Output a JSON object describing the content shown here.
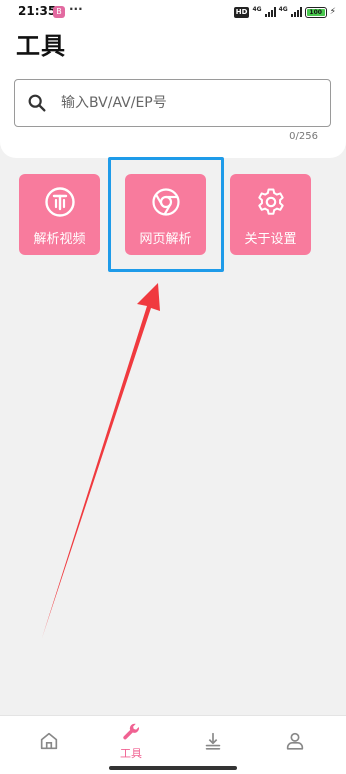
{
  "status_bar": {
    "time": "21:35",
    "app_icon_glyph": "B",
    "more_dots": "···",
    "hd": "HD",
    "network_1": "4G",
    "network_2": "4G",
    "battery": "100",
    "battery_level_percent": 100,
    "charging_icon": "bolt-icon"
  },
  "header": {
    "title": "工具"
  },
  "search": {
    "placeholder": "输入BV/AV/EP号",
    "value": "",
    "counter": "0/256",
    "icon": "search-icon"
  },
  "tools": [
    {
      "label": "解析视频",
      "icon": "coin-icon"
    },
    {
      "label": "网页解析",
      "icon": "chrome-icon"
    },
    {
      "label": "关于设置",
      "icon": "gear-icon"
    }
  ],
  "highlighted_tool": "网页解析",
  "bottom_nav": {
    "items": [
      {
        "label": "",
        "icon": "home-icon",
        "active": false
      },
      {
        "label": "工具",
        "icon": "wrench-icon",
        "active": true
      },
      {
        "label": "",
        "icon": "download-icon",
        "active": false
      },
      {
        "label": "",
        "icon": "person-icon",
        "active": false
      }
    ]
  },
  "colors": {
    "accent": "#f87b9d",
    "nav_active": "#f06292",
    "nav_inactive": "#888888",
    "highlight_box": "#1e9be9",
    "annotation_arrow": "#f03a3f",
    "background": "#f1f1f1"
  }
}
